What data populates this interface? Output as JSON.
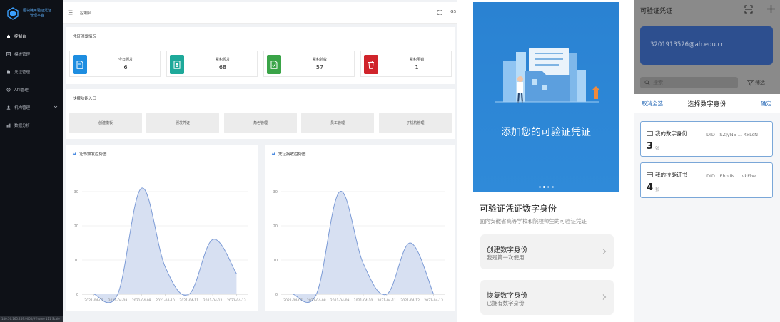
{
  "admin": {
    "logo_text": "区块链可验证凭证\n管理平台",
    "nav": [
      {
        "label": "控制台",
        "icon": "home-icon",
        "active": true
      },
      {
        "label": "模板管理",
        "icon": "template-icon"
      },
      {
        "label": "凭证管理",
        "icon": "credential-icon"
      },
      {
        "label": "API管理",
        "icon": "api-icon"
      },
      {
        "label": "机构管理",
        "icon": "org-icon",
        "has_children": true
      },
      {
        "label": "数据分析",
        "icon": "analytics-icon"
      }
    ],
    "status_url": "140.56.165.249:9000/#/home   111 Scale",
    "breadcrumb": "控制台",
    "user_initials": "GS",
    "overview": {
      "title": "凭证颁发情况",
      "stats": [
        {
          "label": "今日颁发",
          "value": "6",
          "color": "#1e8de0",
          "icon": "document-icon"
        },
        {
          "label": "累积颁发",
          "value": "68",
          "color": "#1ea99a",
          "icon": "stamp-icon"
        },
        {
          "label": "累积验收",
          "value": "57",
          "color": "#3aa448",
          "icon": "check-doc-icon"
        },
        {
          "label": "累积吊销",
          "value": "1",
          "color": "#d0242b",
          "icon": "trash-icon"
        }
      ]
    },
    "quick": {
      "title": "快捷功能入口",
      "buttons": [
        "创建模板",
        "颁发凭证",
        "角色管理",
        "员工管理",
        "子机构管理"
      ]
    }
  },
  "chart_data": [
    {
      "type": "area",
      "title": "证书颁发趋势图",
      "categories": [
        "2021-04-07",
        "2021-04-08",
        "2021-04-09",
        "2021-04-10",
        "2021-04-11",
        "2021-04-12",
        "2021-04-13"
      ],
      "values": [
        0,
        0,
        31,
        8,
        0,
        16,
        6
      ],
      "ylim": [
        0,
        30
      ],
      "yticks": [
        0,
        10,
        20,
        30
      ],
      "grid": true,
      "color": "#7c9bd6",
      "fill": "#d7e0f2"
    },
    {
      "type": "area",
      "title": "凭证接收趋势图",
      "categories": [
        "2021-04-07",
        "2021-04-08",
        "2021-04-09",
        "2021-04-10",
        "2021-04-11",
        "2021-04-12",
        "2021-04-13"
      ],
      "values": [
        0,
        0,
        30,
        9,
        0,
        15,
        0
      ],
      "ylim": [
        0,
        30
      ],
      "yticks": [
        0,
        10,
        20,
        30
      ],
      "grid": true,
      "color": "#7c9bd6",
      "fill": "#d7e0f2"
    }
  ],
  "mobile1": {
    "banner_title": "添加您的可验证凭证",
    "title": "可验证凭证数字身份",
    "subtitle": "面向安徽省高等学校和院校师生的可验证凭证",
    "actions": [
      {
        "title": "创建数字身份",
        "subtitle": "我是第一次使用"
      },
      {
        "title": "恢复数字身份",
        "subtitle": "已拥有数字身份"
      }
    ]
  },
  "mobile2": {
    "title": "可验证凭证",
    "email": "3201913526@ah.edu.cn",
    "search_placeholder": "搜索",
    "filter_label": "筛选",
    "sheet": {
      "cancel": "取消全选",
      "title": "选择数字身份",
      "confirm": "确定",
      "items": [
        {
          "name": "我的数字身份",
          "did": "DID：SZJyN5 ... 4xLsN",
          "count": "3",
          "unit": "张"
        },
        {
          "name": "我的技能证书",
          "did": "DID：EhpiiN ... vkFbe",
          "count": "4",
          "unit": "张"
        }
      ]
    }
  }
}
